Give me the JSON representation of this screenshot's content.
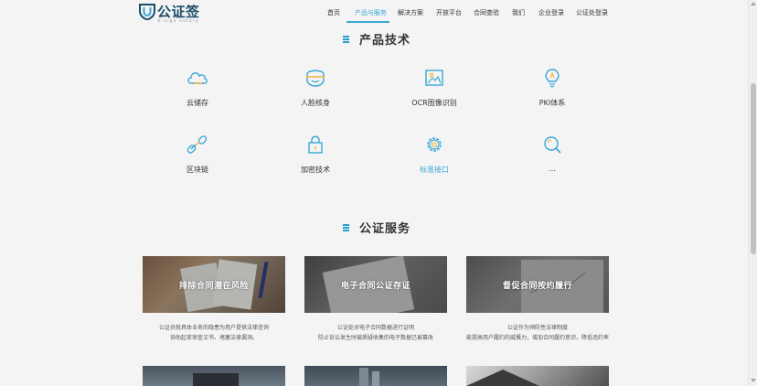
{
  "header": {
    "logo_text": "公证签",
    "logo_subtitle": "E-sign notary",
    "nav": [
      {
        "label": "首页",
        "active": false
      },
      {
        "label": "产品与服务",
        "active": true
      },
      {
        "label": "解决方案",
        "active": false
      },
      {
        "label": "开放平台",
        "active": false
      },
      {
        "label": "合同查验",
        "active": false
      },
      {
        "label": "我们",
        "active": false
      },
      {
        "label": "企业登录",
        "active": false
      },
      {
        "label": "公证处登录",
        "active": false
      }
    ]
  },
  "tech_section": {
    "title": "产品技术",
    "items": [
      {
        "label": "云储存",
        "icon": "cloud-icon"
      },
      {
        "label": "人脸核身",
        "icon": "face-scan-icon"
      },
      {
        "label": "OCR图像识别",
        "icon": "image-icon"
      },
      {
        "label": "PKI体系",
        "icon": "bulb-icon"
      },
      {
        "label": "区块链",
        "icon": "chain-link-icon"
      },
      {
        "label": "加密技术",
        "icon": "lock-icon"
      },
      {
        "label": "标准接口",
        "icon": "gear-icon",
        "highlight": true
      },
      {
        "label": "...",
        "icon": "search-icon"
      }
    ]
  },
  "service_section": {
    "title": "公证服务",
    "cards": [
      {
        "title": "排除合同潜在风险",
        "desc_lines": [
          "公证员就具体业务的隐患为用户提供法律咨询",
          "协助起草审查文书、堵塞法律漏洞。"
        ]
      },
      {
        "title": "电子合同公证存证",
        "desc_lines": [
          "公证处对电子合同数据进行证明",
          "防止诉讼发生时被质疑收集的电子数据已被篡改"
        ]
      },
      {
        "title": "督促合同按约履行",
        "desc_lines": [
          "公证作为预防性法律制度",
          "能提高用户履约的威慑力，增加合同履约意识，降低违约率"
        ]
      }
    ]
  },
  "colors": {
    "accent": "#3aa7d6",
    "logo": "#1b4e6b",
    "background": "#f4f4f4"
  }
}
